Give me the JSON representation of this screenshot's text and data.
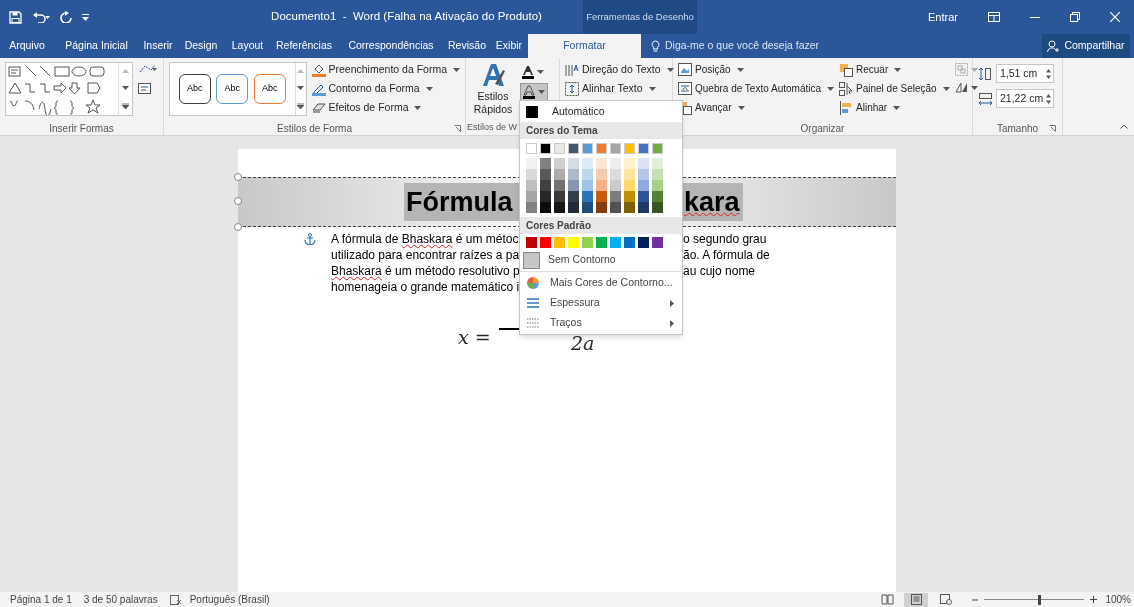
{
  "title_bar": {
    "title": "Documento1  -  Word (Falha na Ativação do Produto)",
    "context_tab": "Ferramentas de Desenho",
    "sign_in": "Entrar"
  },
  "tabs": [
    {
      "label": "Arquivo",
      "selected": false
    },
    {
      "label": "Página Inicial",
      "selected": false
    },
    {
      "label": "Inserir",
      "selected": false
    },
    {
      "label": "Design",
      "selected": false
    },
    {
      "label": "Layout",
      "selected": false
    },
    {
      "label": "Referências",
      "selected": false
    },
    {
      "label": "Correspondências",
      "selected": false
    },
    {
      "label": "Revisão",
      "selected": false
    },
    {
      "label": "Exibir",
      "selected": false
    },
    {
      "label": "Formatar",
      "selected": true
    }
  ],
  "tell_me": {
    "placeholder": "Diga-me o que você deseja fazer"
  },
  "share": "Compartilhar",
  "ribbon": {
    "insert_shapes": {
      "label": "Inserir Formas"
    },
    "shape_styles": {
      "styles": [
        {
          "label": "Abc",
          "color": "#404040"
        },
        {
          "label": "Abc",
          "color": "#5b9bd5"
        },
        {
          "label": "Abc",
          "color": "#ed7d31"
        }
      ],
      "commands": [
        "Preenchimento da Forma",
        "Contorno da Forma",
        "Efeitos de Forma"
      ],
      "label": "Estilos de Forma"
    },
    "wordart_styles": {
      "quick_styles": "Estilos Rápidos",
      "outline_open": true,
      "label": "Estilos de W"
    },
    "text": {
      "commands": [
        "Direção do Texto",
        "Alinhar Texto"
      ]
    },
    "arrange": {
      "commands": [
        "Posição",
        "Quebra de Texto Automática",
        "Avançar",
        "Recuar",
        "Painel de Seleção",
        "Alinhar"
      ],
      "label": "Organizar"
    },
    "size": {
      "height": "1,51 cm",
      "width": "21,22 cm",
      "label": "Tamanho"
    }
  },
  "document": {
    "title_parts": [
      {
        "text": "Fórmula",
        "spelling_error": false
      },
      {
        "text": "kara",
        "spelling_error": true
      }
    ],
    "lines": [
      {
        "left": [
          {
            "text": "A fórmula de ",
            "spelling_error": false
          },
          {
            "text": "Bhaskara",
            "spelling_error": true
          },
          {
            "text": " é um métoc",
            "spelling_error": false
          }
        ],
        "right": "o segundo grau"
      },
      {
        "left": [
          {
            "text": "utilizado para encontrar raízes a pa",
            "spelling_error": false
          }
        ],
        "right": "ão. A fórmula de"
      },
      {
        "left": [
          {
            "text": "Bhaskara",
            "spelling_error": true
          },
          {
            "text": " é um método resolutivo p",
            "spelling_error": false
          }
        ],
        "right": "au cujo nome"
      },
      {
        "left": [
          {
            "text": "homenageia o grande matemático i",
            "spelling_error": false
          }
        ]
      }
    ],
    "formula": {
      "lhs": "x =",
      "denominator": "2a"
    }
  },
  "outline_menu": {
    "automatic": "Automático",
    "theme_header": "Cores do Tema",
    "theme_colors": [
      {
        "color": "#ffffff",
        "shades": [
          {
            "color": "#f2f2f2"
          },
          {
            "color": "#d9d9d9"
          },
          {
            "color": "#bfbfbf"
          },
          {
            "color": "#a6a6a6"
          },
          {
            "color": "#808080"
          }
        ]
      },
      {
        "color": "#000000",
        "shades": [
          {
            "color": "#808080"
          },
          {
            "color": "#595959"
          },
          {
            "color": "#404040"
          },
          {
            "color": "#262626"
          },
          {
            "color": "#0d0d0d"
          }
        ]
      },
      {
        "color": "#e7e6e6",
        "shades": [
          {
            "color": "#d0cece"
          },
          {
            "color": "#aeabab"
          },
          {
            "color": "#757171"
          },
          {
            "color": "#3a3838"
          },
          {
            "color": "#171616"
          }
        ]
      },
      {
        "color": "#44546a",
        "shades": [
          {
            "color": "#d6dce4"
          },
          {
            "color": "#adb9ca"
          },
          {
            "color": "#8496b0"
          },
          {
            "color": "#333f4f"
          },
          {
            "color": "#222a35"
          }
        ]
      },
      {
        "color": "#5b9bd5",
        "shades": [
          {
            "color": "#deebf6"
          },
          {
            "color": "#bdd7ee"
          },
          {
            "color": "#9dc3e6"
          },
          {
            "color": "#2e75b5"
          },
          {
            "color": "#1f4e79"
          }
        ]
      },
      {
        "color": "#ed7d31",
        "shades": [
          {
            "color": "#fbe5d5"
          },
          {
            "color": "#f7cbac"
          },
          {
            "color": "#f4b183"
          },
          {
            "color": "#c55a11"
          },
          {
            "color": "#833c0b"
          }
        ]
      },
      {
        "color": "#a5a5a5",
        "shades": [
          {
            "color": "#ededed"
          },
          {
            "color": "#dbdbdb"
          },
          {
            "color": "#c9c9c9"
          },
          {
            "color": "#7b7b7b"
          },
          {
            "color": "#525252"
          }
        ]
      },
      {
        "color": "#ffc000",
        "shades": [
          {
            "color": "#fff2cc"
          },
          {
            "color": "#fee599"
          },
          {
            "color": "#ffd965"
          },
          {
            "color": "#bf9000"
          },
          {
            "color": "#7f6000"
          }
        ]
      },
      {
        "color": "#4472c4",
        "shades": [
          {
            "color": "#dae3f3"
          },
          {
            "color": "#b4c7e7"
          },
          {
            "color": "#8faadc"
          },
          {
            "color": "#2f5496"
          },
          {
            "color": "#1f3864"
          }
        ]
      },
      {
        "color": "#70ad47",
        "shades": [
          {
            "color": "#e2efd9"
          },
          {
            "color": "#c5e0b3"
          },
          {
            "color": "#a8d08d"
          },
          {
            "color": "#538135"
          },
          {
            "color": "#375623"
          }
        ]
      }
    ],
    "standard_header": "Cores Padrão",
    "standard_colors": [
      {
        "color": "#c00000"
      },
      {
        "color": "#ff0000"
      },
      {
        "color": "#ffc000"
      },
      {
        "color": "#ffff00"
      },
      {
        "color": "#92d050"
      },
      {
        "color": "#00b050"
      },
      {
        "color": "#00b0f0"
      },
      {
        "color": "#0070c0"
      },
      {
        "color": "#002060"
      },
      {
        "color": "#7030a0"
      }
    ],
    "no_outline": "Sem Contorno",
    "items": [
      {
        "kind": "palette",
        "label": "Mais Cores de Contorno..."
      },
      {
        "kind": "weight",
        "label": "Espessura"
      },
      {
        "kind": "dashes",
        "label": "Traços"
      }
    ]
  },
  "status_bar": {
    "page": "Página 1 de 1",
    "words": "3 de 50 palavras",
    "language": "Português (Brasil)",
    "views": [
      {
        "selected": false
      },
      {
        "selected": true
      },
      {
        "selected": false
      }
    ],
    "zoom": {
      "level": 0.55,
      "reading": "100%"
    }
  }
}
